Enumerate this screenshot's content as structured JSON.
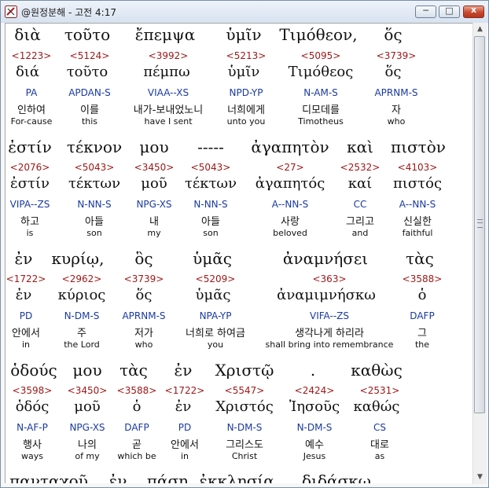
{
  "window": {
    "title": "@원정분해 - 고전 4:17",
    "minimize_glyph": "─",
    "maximize_glyph": "□",
    "close_glyph": "x"
  },
  "blocks": [
    {
      "words": [
        {
          "greek": "διὰ",
          "strong": "<1223>",
          "lemma": "διά",
          "parsing": "PA",
          "korean": "인하여",
          "english": "For-cause"
        },
        {
          "greek": "τοῦτο",
          "strong": "<5124>",
          "lemma": "τοῦτο",
          "parsing": "APDAN-S",
          "korean": "이를",
          "english": "this"
        },
        {
          "greek": "ἔπεμψα",
          "strong": "<3992>",
          "lemma": "πέμπω",
          "parsing": "VIAA--XS",
          "korean": "내가-보내었노니",
          "english": "have I sent"
        },
        {
          "greek": "ὑμῖν",
          "strong": "<5213>",
          "lemma": "ὑμῖν",
          "parsing": "NPD-YP",
          "korean": "너희에게",
          "english": "unto you"
        },
        {
          "greek": "Τιμόθεον,",
          "strong": "<5095>",
          "lemma": "Τιμόθεος",
          "parsing": "N-AM-S",
          "korean": "디모데를",
          "english": "Timotheus"
        },
        {
          "greek": "ὅς",
          "strong": "<3739>",
          "lemma": "ὅς",
          "parsing": "APRNM-S",
          "korean": "자",
          "english": "who"
        }
      ]
    },
    {
      "words": [
        {
          "greek": "ἐστίν",
          "strong": "<2076>",
          "lemma": "ἐστίν",
          "parsing": "VIPA--ZS",
          "korean": "하고",
          "english": "is"
        },
        {
          "greek": "τέκνον",
          "strong": "<5043>",
          "lemma": "τέκτων",
          "parsing": "N-NN-S",
          "korean": "아들",
          "english": "son"
        },
        {
          "greek": "μου",
          "strong": "<3450>",
          "lemma": "μοῦ",
          "parsing": "NPG-XS",
          "korean": "내",
          "english": "my"
        },
        {
          "greek": "-----",
          "strong": "<5043>",
          "lemma": "τέκτων",
          "parsing": "N-NN-S",
          "korean": "아들",
          "english": "son"
        },
        {
          "greek": "ἀγαπητὸν",
          "strong": "<27>",
          "lemma": "ἀγαπητός",
          "parsing": "A--NN-S",
          "korean": "사랑",
          "english": "beloved"
        },
        {
          "greek": "καὶ",
          "strong": "<2532>",
          "lemma": "καί",
          "parsing": "CC",
          "korean": "그리고",
          "english": "and"
        },
        {
          "greek": "πιστὸν",
          "strong": "<4103>",
          "lemma": "πιστός",
          "parsing": "A--NN-S",
          "korean": "신실한",
          "english": "faithful"
        }
      ]
    },
    {
      "words": [
        {
          "greek": "ἐν",
          "strong": "<1722>",
          "lemma": "ἐν",
          "parsing": "PD",
          "korean": "안에서",
          "english": "in"
        },
        {
          "greek": "κυρίῳ,",
          "strong": "<2962>",
          "lemma": "κύριος",
          "parsing": "N-DM-S",
          "korean": "주",
          "english": "the Lord"
        },
        {
          "greek": "ὃς",
          "strong": "<3739>",
          "lemma": "ὅς",
          "parsing": "APRNM-S",
          "korean": "저가",
          "english": "who"
        },
        {
          "greek": "ὑμᾶς",
          "strong": "<5209>",
          "lemma": "ὑμᾶς",
          "parsing": "NPA-YP",
          "korean": "너희로 하여금",
          "english": "you"
        },
        {
          "greek": "ἀναμνήσει",
          "strong": "<363>",
          "lemma": "ἀναμιμνήσκω",
          "parsing": "VIFA--ZS",
          "korean": "생각나게 하리라",
          "english": "shall bring into remembrance"
        },
        {
          "greek": "τὰς",
          "strong": "<3588>",
          "lemma": "ὁ",
          "parsing": "DAFP",
          "korean": "그",
          "english": "the"
        }
      ]
    },
    {
      "words": [
        {
          "greek": "ὁδούς",
          "strong": "<3598>",
          "lemma": "ὁδός",
          "parsing": "N-AF-P",
          "korean": "행사",
          "english": "ways"
        },
        {
          "greek": "μου",
          "strong": "<3450>",
          "lemma": "μοῦ",
          "parsing": "NPG-XS",
          "korean": "나의",
          "english": "of my"
        },
        {
          "greek": "τὰς",
          "strong": "<3588>",
          "lemma": "ὁ",
          "parsing": "DAFP",
          "korean": "곧",
          "english": "which be"
        },
        {
          "greek": "ἐν",
          "strong": "<1722>",
          "lemma": "ἐν",
          "parsing": "PD",
          "korean": "안에서",
          "english": "in"
        },
        {
          "greek": "Χριστῷ",
          "strong": "<5547>",
          "lemma": "Χριστός",
          "parsing": "N-DM-S",
          "korean": "그리스도",
          "english": "Christ"
        },
        {
          "greek": ".",
          "strong": "<2424>",
          "lemma": "Ἰησοῦς",
          "parsing": "N-DM-S",
          "korean": "예수",
          "english": "Jesus"
        },
        {
          "greek": "καθὼς",
          "strong": "<2531>",
          "lemma": "καθώς",
          "parsing": "CS",
          "korean": "대로",
          "english": "as"
        }
      ]
    },
    {
      "words": [
        {
          "greek": "πανταχοῦ"
        },
        {
          "greek": "ἐν"
        },
        {
          "greek": "πάσῃ"
        },
        {
          "greek": "ἐκκλησίᾳ"
        },
        {
          "greek": "διδάσκω"
        }
      ]
    }
  ]
}
